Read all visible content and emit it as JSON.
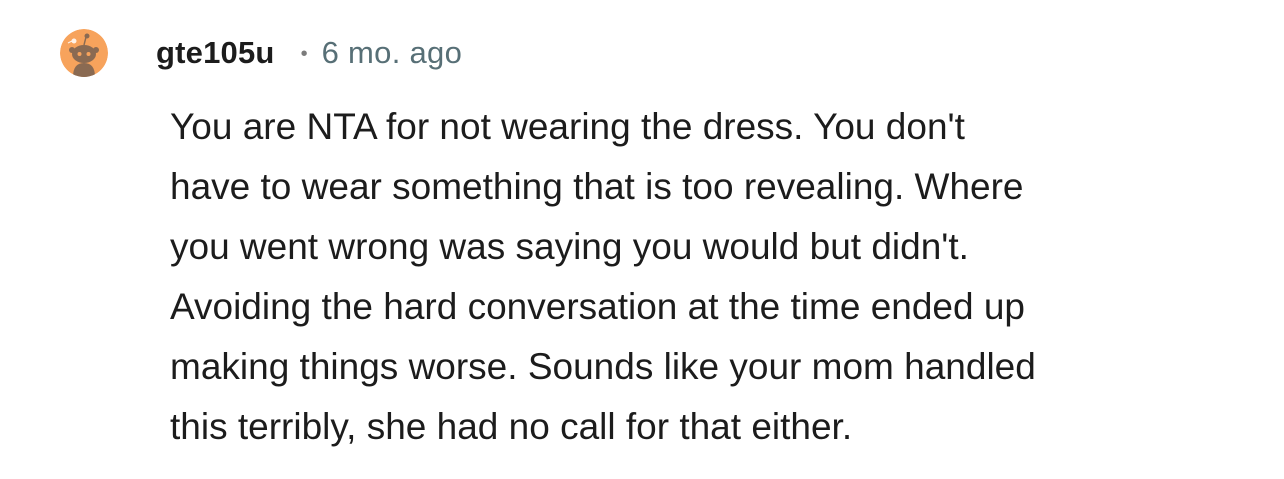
{
  "comment": {
    "username": "gte105u",
    "separator": "•",
    "timestamp": "6 mo. ago",
    "avatar_icon": "reddit-snoo-avatar-icon",
    "avatar_color": "#f7a35c",
    "body_lines": [
      "You are NTA for not wearing the dress. You don't",
      "have to wear something that is too revealing. Where",
      "you went wrong was saying you would but didn't.",
      "Avoiding the hard conversation at the time ended up",
      "making things worse. Sounds like your mom handled",
      "this terribly, she had no call for that either."
    ]
  }
}
